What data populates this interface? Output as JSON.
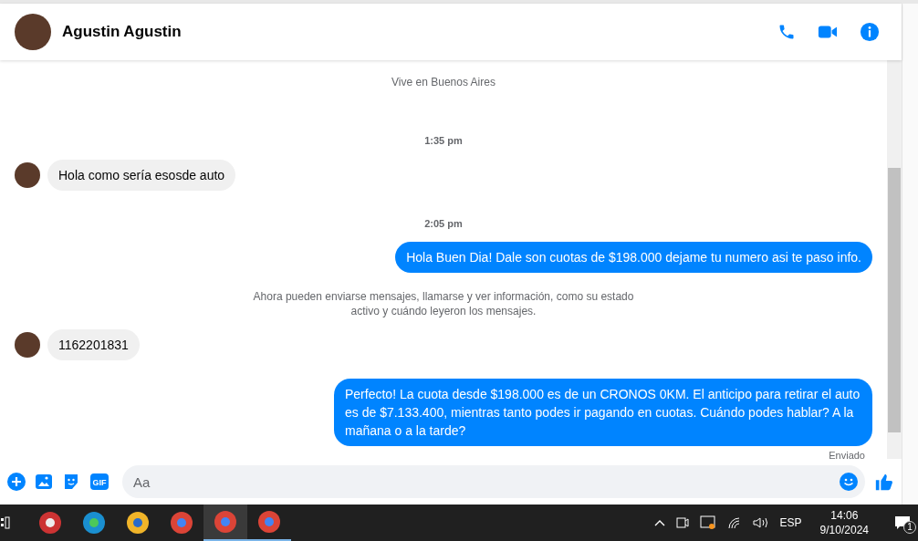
{
  "header": {
    "name": "Agustin Agustin"
  },
  "messages": [
    {
      "kind": "system",
      "text": "Vive en Buenos Aires"
    },
    {
      "kind": "time",
      "text": "1:35 pm"
    },
    {
      "kind": "incoming",
      "text": "Hola como sería esosde auto"
    },
    {
      "kind": "time",
      "text": "2:05 pm"
    },
    {
      "kind": "outgoing",
      "text": "Hola Buen Dia! Dale son cuotas de $198.000 dejame tu numero asi te paso info."
    },
    {
      "kind": "system",
      "text": "Ahora pueden enviarse mensajes, llamarse y ver información, como su estado activo y cuándo leyeron los mensajes."
    },
    {
      "kind": "incoming",
      "text": "1162201831"
    },
    {
      "kind": "outgoing",
      "text": "Perfecto! La cuota desde $198.000 es de un CRONOS 0KM. El anticipo para retirar el auto es de $7.133.400, mientras tanto podes ir pagando en cuotas. Cuándo podes hablar? A la mañana o a la tarde?"
    },
    {
      "kind": "status",
      "text": "Enviado"
    }
  ],
  "composer": {
    "gif_label": "GIF",
    "placeholder": "Aa"
  },
  "taskbar": {
    "apps": [
      {
        "selected": false
      },
      {
        "selected": false
      },
      {
        "selected": false
      },
      {
        "selected": false
      },
      {
        "selected": true
      },
      {
        "selected": true
      }
    ],
    "language": "ESP",
    "time": "14:06",
    "date": "9/10/2024",
    "notifications": "1"
  }
}
